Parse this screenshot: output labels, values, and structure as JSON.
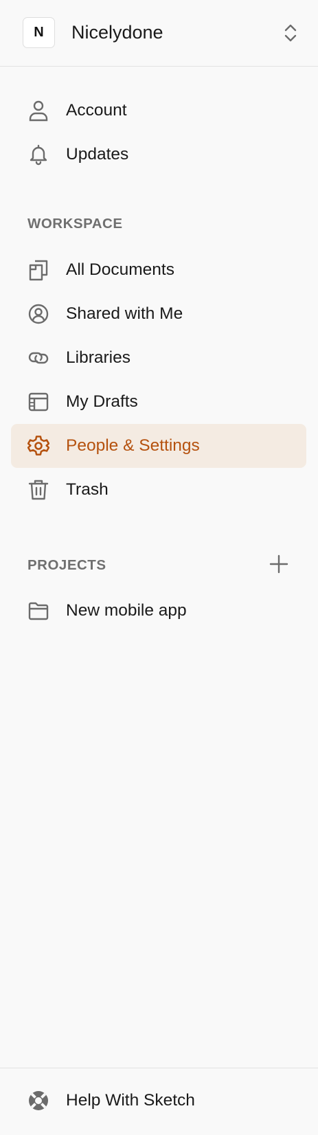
{
  "workspace": {
    "initial": "N",
    "name": "Nicelydone"
  },
  "nav": {
    "top": [
      {
        "label": "Account",
        "icon": "user-icon"
      },
      {
        "label": "Updates",
        "icon": "bell-icon"
      }
    ],
    "workspace_title": "WORKSPACE",
    "workspace_items": [
      {
        "label": "All Documents",
        "icon": "documents-icon"
      },
      {
        "label": "Shared with Me",
        "icon": "user-circle-icon"
      },
      {
        "label": "Libraries",
        "icon": "link-icon"
      },
      {
        "label": "My Drafts",
        "icon": "drafts-icon"
      },
      {
        "label": "People & Settings",
        "icon": "gear-icon",
        "active": true
      },
      {
        "label": "Trash",
        "icon": "trash-icon"
      }
    ],
    "projects_title": "PROJECTS",
    "projects": [
      {
        "label": "New mobile app",
        "icon": "folder-icon"
      }
    ]
  },
  "footer": {
    "help_label": "Help With Sketch",
    "icon": "lifebuoy-icon"
  },
  "colors": {
    "accent": "#b5520f",
    "active_bg": "#f4ebe2",
    "icon": "#6b6b6b"
  }
}
